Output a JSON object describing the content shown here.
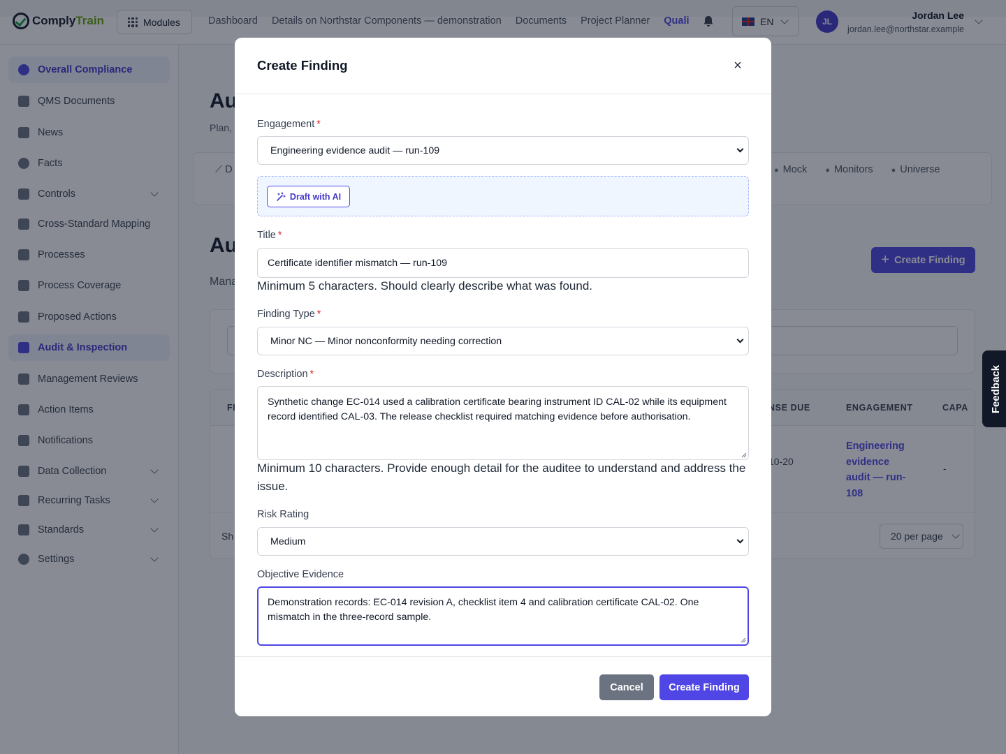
{
  "app": {
    "brand_part1": "Comply",
    "brand_part2": "Train",
    "modules_label": "Modules",
    "topnav": [
      "Dashboard",
      "Details on Northstar Components — demonstration",
      "Documents",
      "Project Planner",
      "Quali"
    ],
    "language": "EN",
    "user": {
      "initials": "JL",
      "name": "Jordan Lee",
      "email": "jordan.lee@northstar.example"
    }
  },
  "sidebar": {
    "items": [
      {
        "label": "Overall Compliance",
        "icon": "pie-chart-icon",
        "active": true
      },
      {
        "label": "QMS Documents",
        "icon": "document-icon"
      },
      {
        "label": "News",
        "icon": "megaphone-icon"
      },
      {
        "label": "Facts",
        "icon": "lightbulb-icon"
      },
      {
        "label": "Controls",
        "icon": "shield-icon",
        "expandable": true
      },
      {
        "label": "Cross-Standard Mapping",
        "icon": "table-icon"
      },
      {
        "label": "Processes",
        "icon": "flow-icon"
      },
      {
        "label": "Process Coverage",
        "icon": "coverage-icon"
      },
      {
        "label": "Proposed Actions",
        "icon": "checklist-icon"
      },
      {
        "label": "Audit & Inspection",
        "icon": "audit-icon",
        "active": true
      },
      {
        "label": "Management Reviews",
        "icon": "review-icon"
      },
      {
        "label": "Action Items",
        "icon": "list-check-icon"
      },
      {
        "label": "Notifications",
        "icon": "bell-icon"
      },
      {
        "label": "Data Collection",
        "icon": "clipboard-icon",
        "expandable": true
      },
      {
        "label": "Recurring Tasks",
        "icon": "repeat-icon",
        "expandable": true
      },
      {
        "label": "Standards",
        "icon": "bookmark-icon",
        "expandable": true
      },
      {
        "label": "Settings",
        "icon": "gear-icon",
        "expandable": true
      }
    ]
  },
  "background": {
    "page_title": "Au",
    "page_subtitle": "Plan,",
    "tabs": [
      "Mock",
      "Monitors",
      "Universe"
    ],
    "tab_d": "D",
    "section_title": "Au",
    "section_subtitle": "Mana",
    "create_button": "Create Finding",
    "columns": [
      "FI",
      "NSE DUE",
      "ENGAGEMENT",
      "CAPA"
    ],
    "row": {
      "due": "10-20",
      "engagement": "Engineering evidence audit — run-108",
      "capa": "-"
    },
    "footer_partial": "Sh",
    "per_page": "20 per page",
    "feedback": "Feedback"
  },
  "modal": {
    "title": "Create Finding",
    "close_symbol": "×",
    "engagement": {
      "label": "Engagement",
      "value": "Engineering evidence audit — run-109"
    },
    "draft_ai_label": "Draft with AI",
    "title_field": {
      "label": "Title",
      "value": "Certificate identifier mismatch — run-109",
      "hint": "Minimum 5 characters. Should clearly describe what was found."
    },
    "finding_type": {
      "label": "Finding Type",
      "value": "Minor NC — Minor nonconformity needing correction"
    },
    "description": {
      "label": "Description",
      "value": "Synthetic change EC-014 used a calibration certificate bearing instrument ID CAL-02 while its equipment record identified CAL-03. The release checklist required matching evidence before authorisation.",
      "hint": "Minimum 10 characters. Provide enough detail for the auditee to understand and address the issue."
    },
    "risk_rating": {
      "label": "Risk Rating",
      "value": "Medium"
    },
    "objective_evidence": {
      "label": "Objective Evidence",
      "value": "Demonstration records: EC-014 revision A, checklist item 4 and calibration certificate CAL-02. One mismatch in the three-record sample."
    },
    "cancel_label": "Cancel",
    "submit_label": "Create Finding",
    "required_mark": "*"
  },
  "colors": {
    "accent": "#4f46e5",
    "required": "#dc2626",
    "overlay": "rgba(17,24,39,0.5)"
  }
}
